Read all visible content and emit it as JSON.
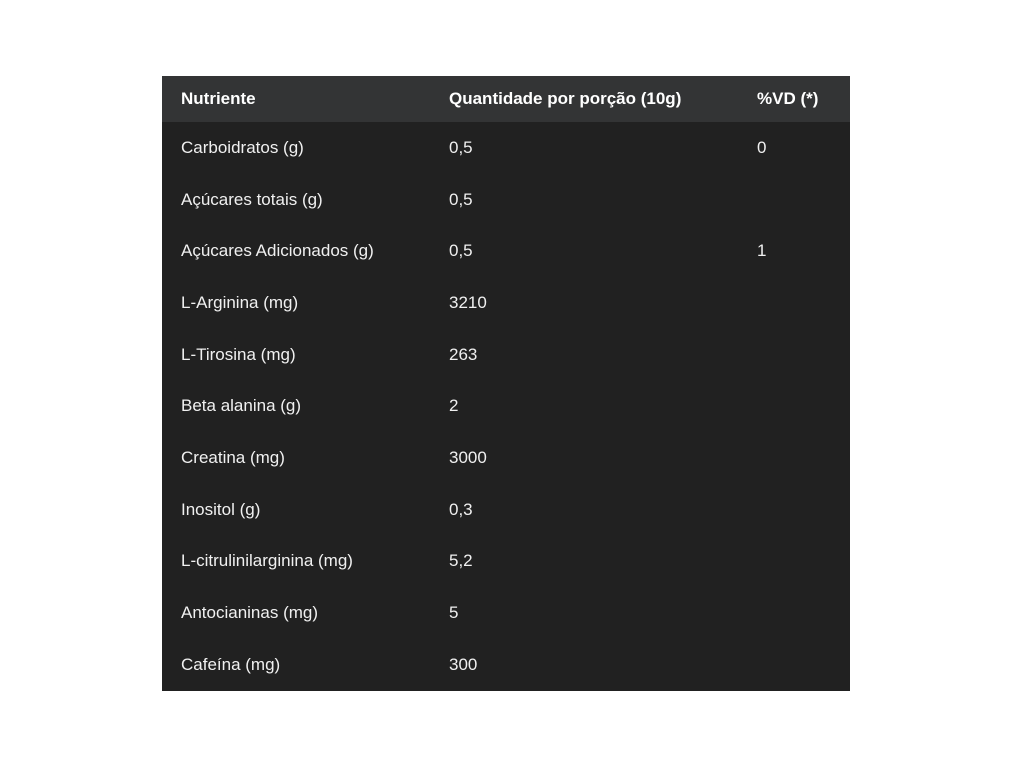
{
  "table": {
    "headers": [
      "Nutriente",
      "Quantidade por porção (10g)",
      "%VD (*)"
    ],
    "rows": [
      [
        "Carboidratos (g)",
        "0,5",
        "0"
      ],
      [
        "Açúcares totais (g)",
        "0,5",
        ""
      ],
      [
        "Açúcares Adicionados (g)",
        "0,5",
        "1"
      ],
      [
        "L-Arginina (mg)",
        "3210",
        ""
      ],
      [
        "L-Tirosina (mg)",
        "263",
        ""
      ],
      [
        "Beta alanina (g)",
        "2",
        ""
      ],
      [
        "Creatina (mg)",
        "3000",
        ""
      ],
      [
        "Inositol (g)",
        "0,3",
        ""
      ],
      [
        "L-citrulinilarginina (mg)",
        "5,2",
        ""
      ],
      [
        "Antocianinas (mg)",
        "5",
        ""
      ],
      [
        "Cafeína (mg)",
        "300",
        ""
      ]
    ]
  },
  "colors": {
    "panel_background": "#212121",
    "header_background": "#333435",
    "text": "#f0f0f0"
  }
}
